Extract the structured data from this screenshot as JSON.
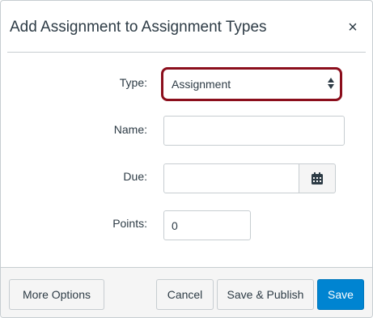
{
  "dialog": {
    "title": "Add Assignment to Assignment Types",
    "close_glyph": "×"
  },
  "form": {
    "type": {
      "label": "Type:",
      "value": "Assignment"
    },
    "name": {
      "label": "Name:",
      "value": ""
    },
    "due": {
      "label": "Due:",
      "value": ""
    },
    "points": {
      "label": "Points:",
      "value": "0"
    }
  },
  "footer": {
    "more_options": "More Options",
    "cancel": "Cancel",
    "save_publish": "Save & Publish",
    "save": "Save"
  },
  "colors": {
    "highlight_border": "#8b0e1c",
    "primary_button": "#0084d1",
    "footer_bg": "#f5f5f5",
    "border": "#c7cdd1",
    "text": "#2d3b45"
  },
  "icons": {
    "close": "close-icon",
    "select_arrows": "sort-arrows-icon",
    "calendar": "calendar-icon"
  }
}
